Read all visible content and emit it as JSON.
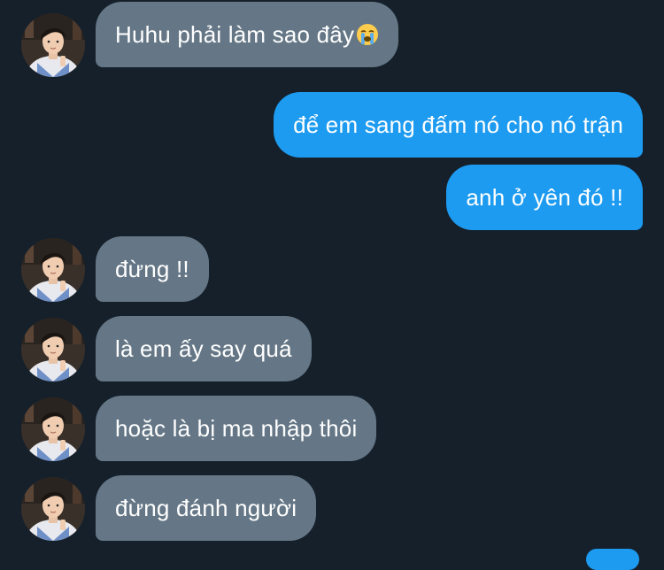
{
  "conversation": {
    "messages": [
      {
        "side": "in",
        "text": "Huhu phải làm sao đây",
        "emoji": "loudly-crying-face"
      },
      {
        "side": "out",
        "text": "để em sang đấm nó cho nó trận"
      },
      {
        "side": "out",
        "text": "anh ở yên đó !!"
      },
      {
        "side": "in",
        "text": "đừng !!"
      },
      {
        "side": "in",
        "text": "là em ấy say quá"
      },
      {
        "side": "in",
        "text": "hoặc là bị ma nhập thôi"
      },
      {
        "side": "in",
        "text": "đừng đánh người"
      }
    ]
  },
  "colors": {
    "background": "#15202b",
    "incoming_bubble": "#657786",
    "outgoing_bubble": "#1d9bf0",
    "text": "#ffffff"
  }
}
